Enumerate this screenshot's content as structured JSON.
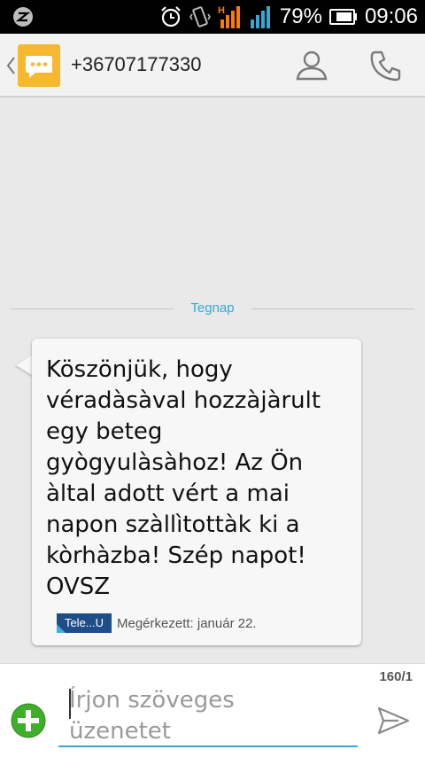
{
  "status_bar": {
    "battery_percent": "79%",
    "time": "09:06",
    "network_label": "H",
    "icons": [
      "zte-logo-icon",
      "alarm-icon",
      "vibrate-icon",
      "signal-icon",
      "signal-icon",
      "battery-icon"
    ]
  },
  "header": {
    "contact": "+36707177330",
    "icons": [
      "back-chevron-icon",
      "messaging-app-icon",
      "contact-person-icon",
      "phone-call-icon"
    ]
  },
  "conversation": {
    "date_divider": "Tegnap",
    "messages": [
      {
        "text": "Köszönjük, hogy\nvéradàsàval hozzàjàrult\negy beteg\ngyògyulàsàhoz! Az Ön\nàltal adott vért a mai\nnapon szàllìtottàk ki a\nkòrhàzba! Szép napot!\nOVSZ",
        "sim_label": "Tele...U",
        "status": "Megérkezett: január 22."
      }
    ]
  },
  "compose": {
    "char_count": "160/1",
    "placeholder": "Írjon szöveges\nüzenetet",
    "icons": [
      "add-attachment-icon",
      "send-icon"
    ]
  },
  "colors": {
    "accent": "#33a9d8",
    "app_icon": "#f5b82e",
    "add_button": "#3fae2a",
    "background": "#e9e9e9"
  }
}
